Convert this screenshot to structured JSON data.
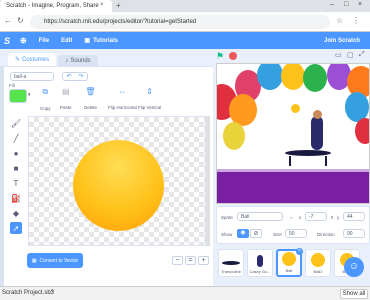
{
  "browser": {
    "tab_title": "Scratch - Imagine, Program, Share",
    "url": "https://scratch.mit.edu/projects/editor/?tutorial=getStarted",
    "new_tab": "+",
    "minimize": "–",
    "maximize": "□",
    "close": "×"
  },
  "menu": {
    "file": "File",
    "edit": "Edit",
    "tutorials": "Tutorials",
    "join": "Join Scratch"
  },
  "tabs": {
    "costumes": "Costumes",
    "sounds": "Sounds"
  },
  "paint": {
    "costume_name": "ball-a",
    "fill_label": "Fill",
    "copy": "Copy",
    "paste": "Paste",
    "delete": "Delete",
    "flip_h": "Flip Horizontal",
    "flip_v": "Flip Vertical",
    "convert": "Convert to Vector",
    "zoom_out": "−",
    "zoom_reset": "=",
    "zoom_in": "+"
  },
  "sprite_info": {
    "sprite_label": "Sprite",
    "sprite_value": "Ball",
    "x_label": "x",
    "x_value": "-7",
    "y_label": "y",
    "y_value": "44",
    "show_label": "Show",
    "size_label": "Size",
    "size_value": "50",
    "direction_label": "Direction",
    "direction_value": "90"
  },
  "sprites": [
    {
      "name": "Trampoline"
    },
    {
      "name": "Casey Go..."
    },
    {
      "name": "Ball"
    },
    {
      "name": "Ball2"
    },
    {
      "name": "Ball3"
    }
  ],
  "taskbar": {
    "file": "Scratch Project.sb3",
    "show_all": "Show all"
  },
  "colors": {
    "accent": "#4c97ff",
    "ball": "#ffc21a",
    "fill_swatch": "#57e34e",
    "stage_floor": "#7b1fa2"
  }
}
